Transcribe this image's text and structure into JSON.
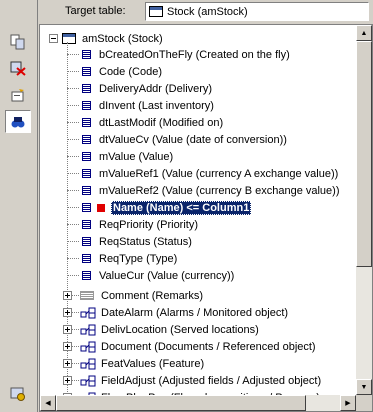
{
  "header": {
    "target_label": "Target table:",
    "target_value": "Stock (amStock)"
  },
  "toolbar": {
    "tools": [
      {
        "icon": "copy-fields-icon"
      },
      {
        "icon": "delete-mapping-icon"
      },
      {
        "icon": "new-field-icon"
      },
      {
        "icon": "mapping-icon",
        "active": true
      },
      {
        "icon": "settings-icon"
      }
    ]
  },
  "tree": {
    "root": "amStock (Stock)",
    "fields": [
      "bCreatedOnTheFly (Created on the fly)",
      "Code (Code)",
      "DeliveryAddr (Delivery)",
      "dInvent (Last inventory)",
      "dtLastModif (Modified on)",
      "dtValueCv (Value (date of conversion))",
      "mValue (Value)",
      "mValueRef1 (Value (currency A exchange value))",
      "mValueRef2 (Value (currency B exchange value))",
      "Name (Name)  <=  Column1",
      "ReqPriority (Priority)",
      "ReqStatus (Status)",
      "ReqType (Type)",
      "ValueCur (Value (currency))"
    ],
    "memo": "Comment (Remarks)",
    "links": [
      "DateAlarm (Alarms / Monitored object)",
      "DelivLocation (Served locations)",
      "Document (Documents / Referenced object)",
      "FeatValues (Feature)",
      "FieldAdjust (Adjusted fields / Adjusted object)",
      "FloorPlanPos (Floorplan positions / Purpose)"
    ],
    "selected_field": "Name (Name)  <=  Column1"
  },
  "colors": {
    "selection": "#0a246a",
    "mapped_marker": "#e00000",
    "panel": "#d4d0c8"
  }
}
